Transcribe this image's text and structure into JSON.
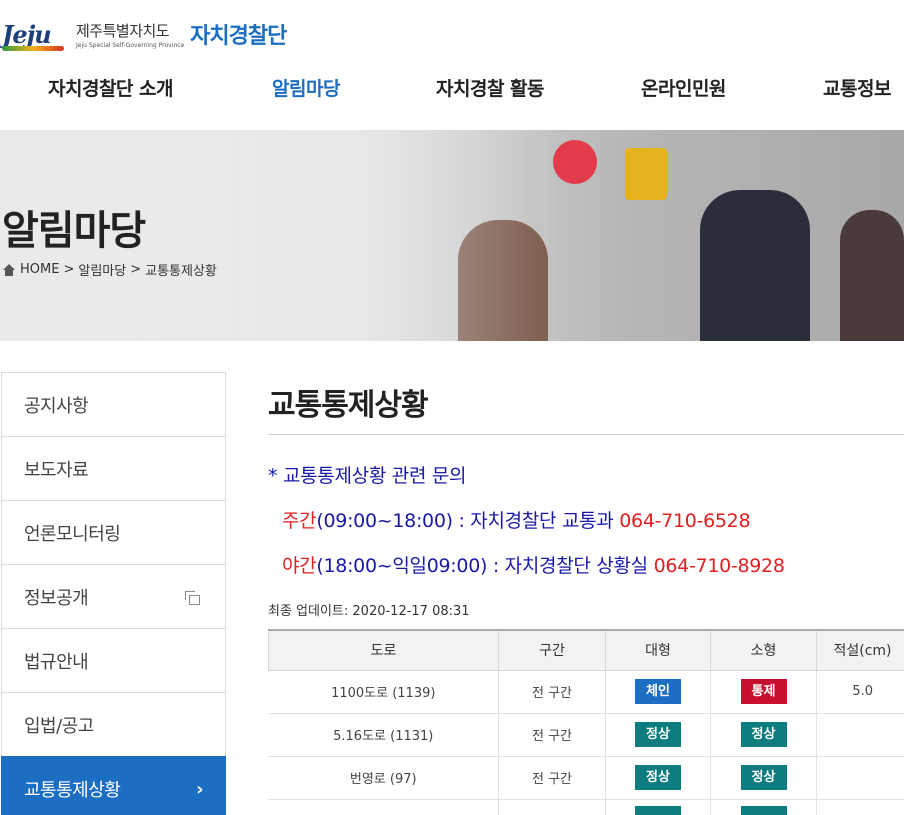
{
  "header": {
    "logo_mark": "Jeju",
    "logo_ko": "제주특별자치도",
    "logo_en": "Jeju Special Self-Governing Province",
    "logo_org": "자치경찰단"
  },
  "nav": [
    {
      "label": "자치경찰단 소개",
      "active": false
    },
    {
      "label": "알림마당",
      "active": true
    },
    {
      "label": "자치경찰 활동",
      "active": false
    },
    {
      "label": "온라인민원",
      "active": false
    },
    {
      "label": "교통정보",
      "active": false
    }
  ],
  "banner": {
    "title": "알림마당",
    "breadcrumb": {
      "home": "HOME",
      "sep1": ">",
      "level1": "알림마당",
      "sep2": ">",
      "level2": "교통통제상황"
    }
  },
  "sidebar": [
    {
      "label": "공지사항",
      "icon": null,
      "active": false
    },
    {
      "label": "보도자료",
      "icon": null,
      "active": false
    },
    {
      "label": "언론모니터링",
      "icon": null,
      "active": false
    },
    {
      "label": "정보공개",
      "icon": "external-window-icon",
      "active": false
    },
    {
      "label": "법규안내",
      "icon": null,
      "active": false
    },
    {
      "label": "입법/공고",
      "icon": null,
      "active": false
    },
    {
      "label": "교통통제상황",
      "icon": "chevron-right-icon",
      "active": true
    }
  ],
  "content": {
    "title": "교통통제상황",
    "notice": {
      "heading": "* 교통통제상황 관련 문의",
      "day_label": "주간",
      "day_hours": "(09:00~18:00) : 자치경찰단 교통과",
      "day_phone": "064-710-6528",
      "night_label": "야간",
      "night_hours": "(18:00~익일09:00) : 자치경찰단 상황실",
      "night_phone": "064-710-8928"
    },
    "updated": "최종 업데이트: 2020-12-17 08:31"
  },
  "table": {
    "headers": [
      "도로",
      "구간",
      "대형",
      "소형",
      "적설(cm)"
    ],
    "rows": [
      {
        "road": "1100도로 (1139)",
        "section": "전 구간",
        "large": "체인",
        "small": "통제",
        "snow": "5.0"
      },
      {
        "road": "5.16도로 (1131)",
        "section": "전 구간",
        "large": "정상",
        "small": "정상",
        "snow": ""
      },
      {
        "road": "번영로 (97)",
        "section": "전 구간",
        "large": "정상",
        "small": "정상",
        "snow": ""
      }
    ]
  },
  "colors": {
    "accent": "#1c6ec2",
    "chain": "#1c6ec2",
    "closed": "#c8102e",
    "normal": "#0d7c7f",
    "notice_blue": "#1a1aa8",
    "notice_red": "#e02020"
  }
}
